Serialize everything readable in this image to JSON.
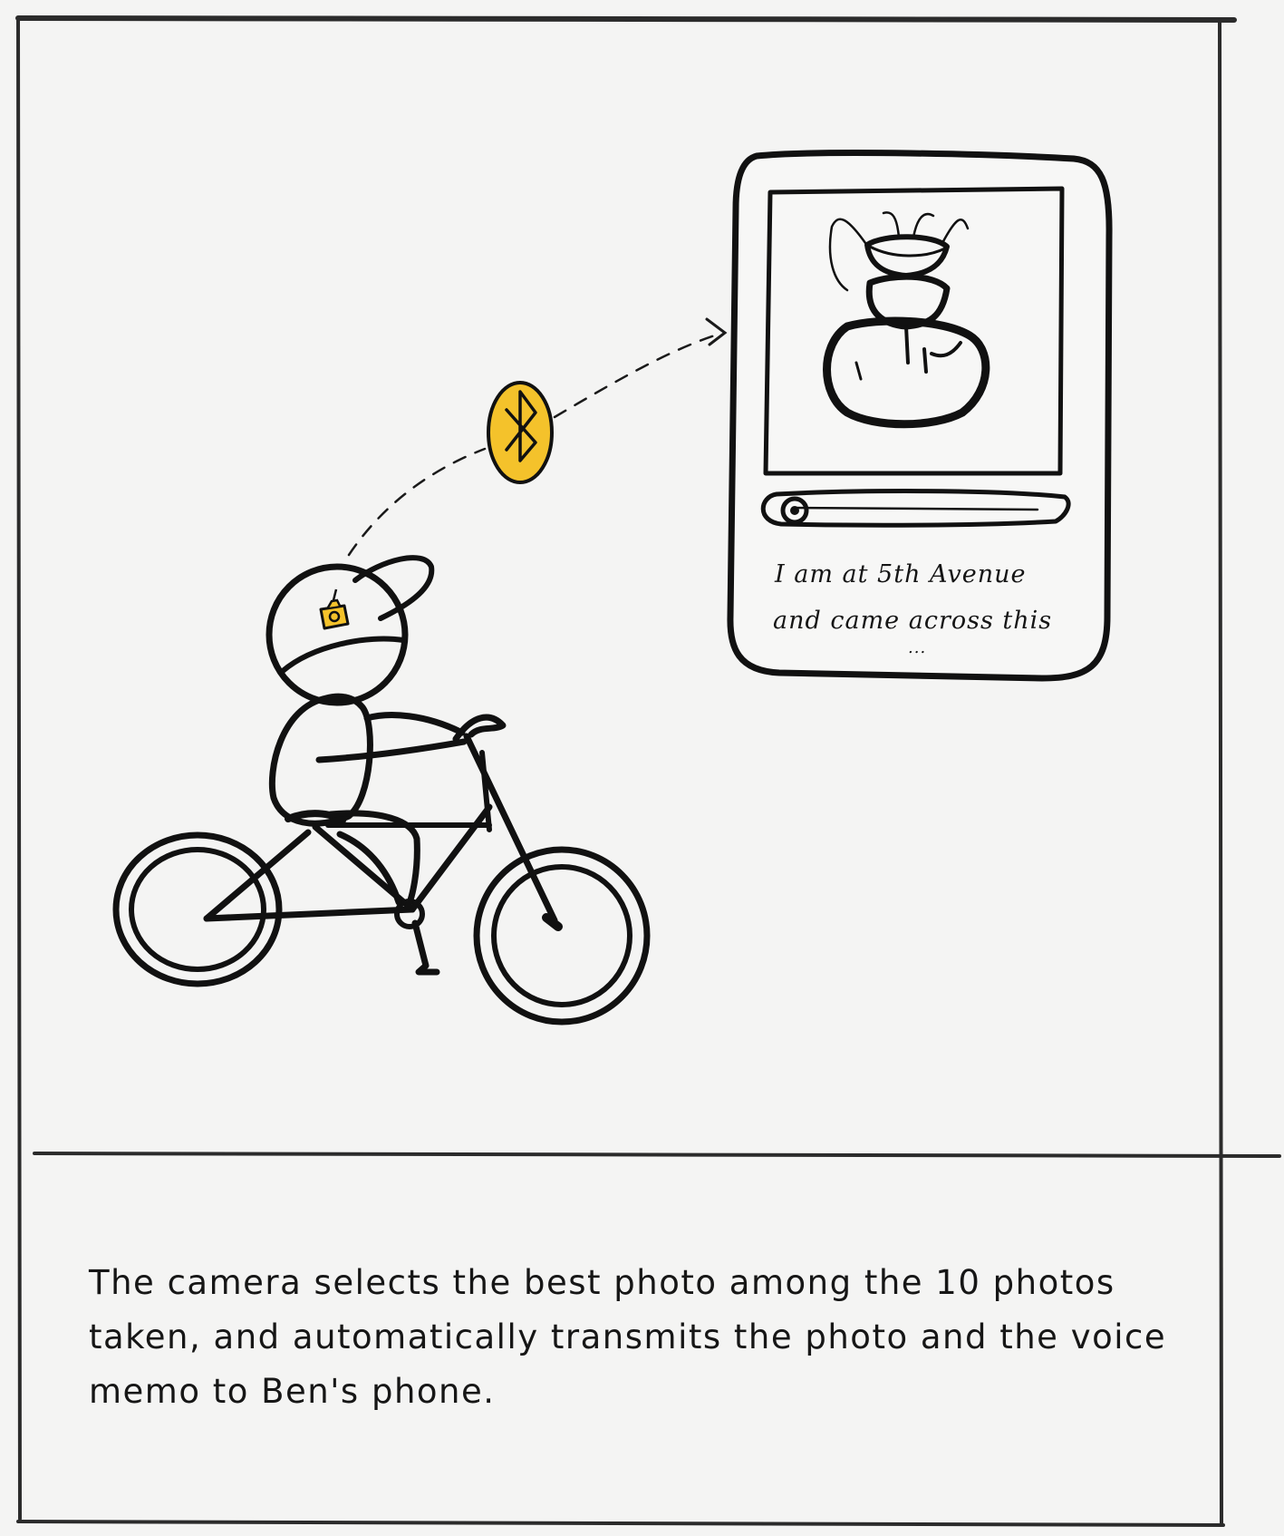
{
  "phone": {
    "message_line1": "I am at 5th Avenue",
    "message_line2": "and came across this",
    "message_ellipsis": "..."
  },
  "caption": {
    "text": "The camera selects the best photo among the 10 photos taken, and automatically transmits the photo and the voice memo to Ben's phone."
  },
  "icons": [
    "bluetooth-icon",
    "camera-icon",
    "bicycle",
    "stick-figure-rider",
    "phone",
    "fountain-photo",
    "audio-playback-bar"
  ],
  "colors": {
    "accent_yellow": "#f4c22b",
    "ink": "#111111",
    "paper": "#f4f4f3"
  }
}
